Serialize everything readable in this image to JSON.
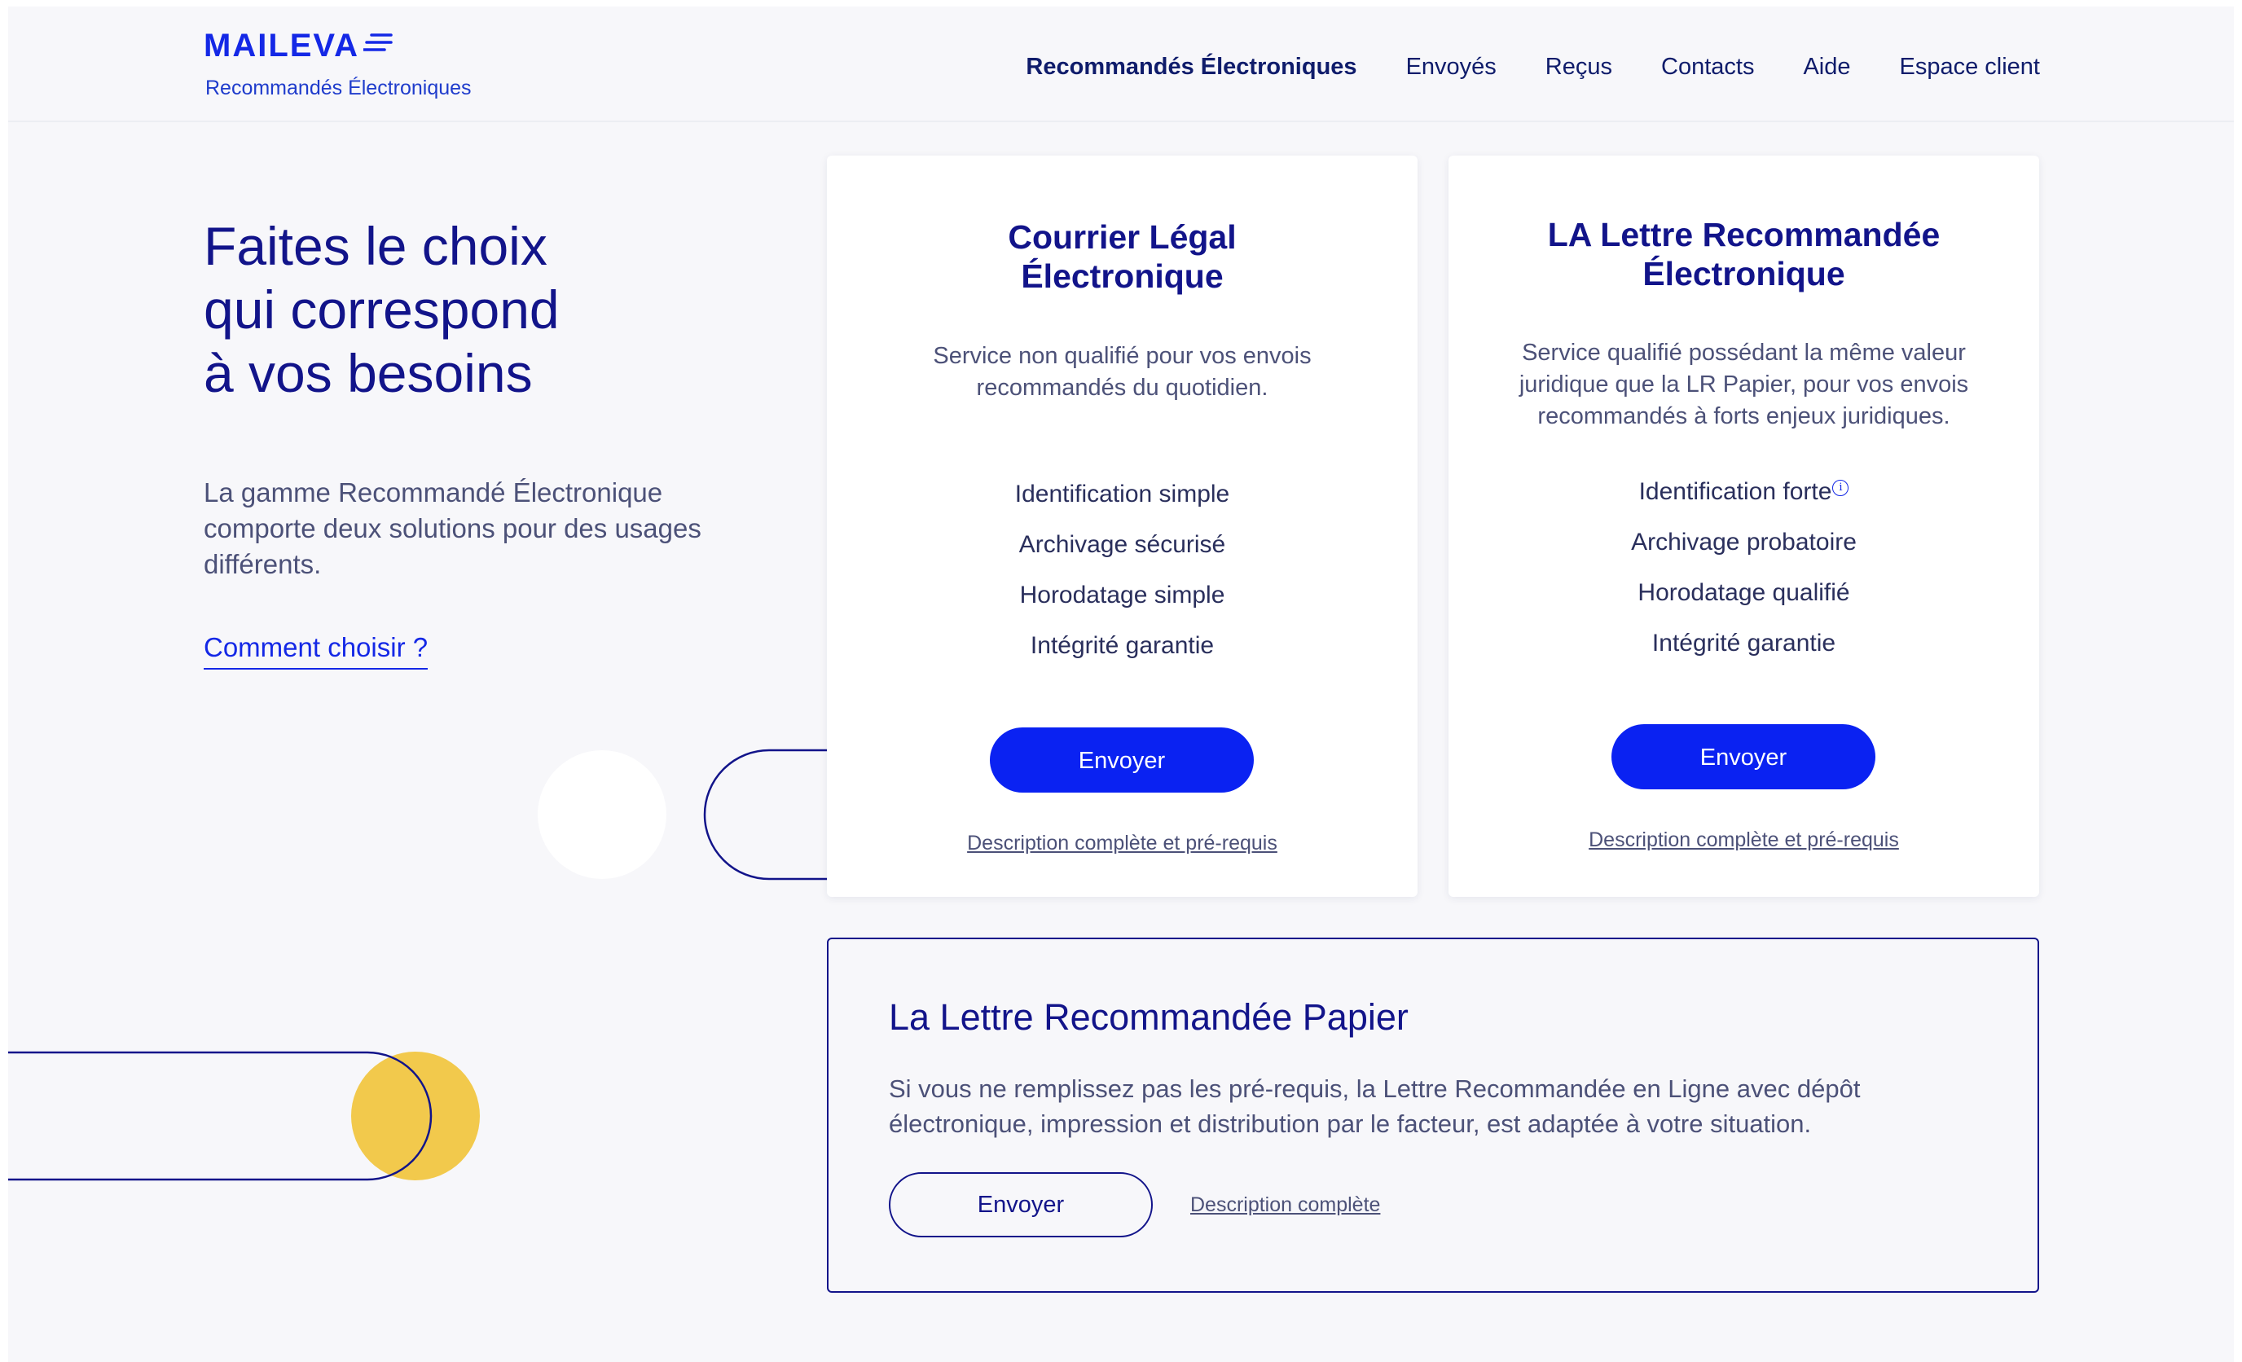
{
  "header": {
    "logo_text": "MAILEVA",
    "logo_subtitle": "Recommandés Électroniques",
    "nav": [
      {
        "label": "Recommandés Électroniques",
        "active": true
      },
      {
        "label": "Envoyés"
      },
      {
        "label": "Reçus"
      },
      {
        "label": "Contacts"
      },
      {
        "label": "Aide"
      },
      {
        "label": "Espace client"
      }
    ]
  },
  "hero": {
    "title_lines": [
      "Faites le choix",
      "qui correspond",
      "à vos besoins"
    ],
    "text": "La gamme Recommandé Électronique comporte deux solutions pour des usages différents.",
    "link": "Comment choisir ?"
  },
  "cards": [
    {
      "title_lines": [
        "Courrier Légal",
        "Électronique"
      ],
      "description": "Service non qualifié pour vos envois recommandés du quotidien.",
      "features": [
        "Identification simple",
        "Archivage sécurisé",
        "Horodatage simple",
        "Intégrité garantie"
      ],
      "button": "Envoyer",
      "link": "Description complète et pré-requis"
    },
    {
      "title_lines": [
        "LA Lettre Recommandée",
        "Électronique"
      ],
      "description": "Service qualifié possédant la même valeur juridique que la LR Papier, pour vos envois recommandés à forts enjeux juridiques.",
      "features": [
        "Identification forte",
        "Archivage probatoire",
        "Horodatage qualifié",
        "Intégrité garantie"
      ],
      "info_icon": "i",
      "button": "Envoyer",
      "link": "Description complète et pré-requis"
    }
  ],
  "paper": {
    "title": "La Lettre Recommandée Papier",
    "text": "Si vous ne remplissez pas les pré-requis, la Lettre Recommandée en Ligne avec dépôt électronique, impression et distribution par le facteur, est adaptée à votre situation.",
    "button": "Envoyer",
    "link": "Description complète"
  },
  "colors": {
    "brand_blue": "#0a22f2",
    "navy": "#12148a",
    "yellow": "#f2c94c",
    "background": "#f7f7fa"
  }
}
